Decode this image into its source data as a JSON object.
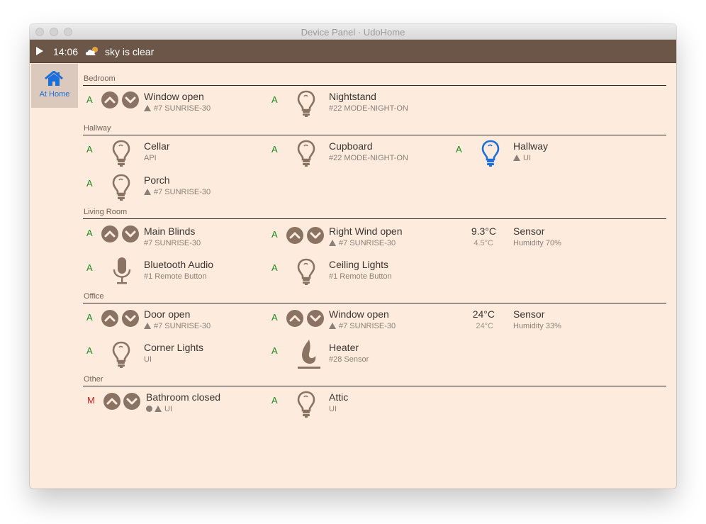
{
  "window": {
    "title": "Device Panel · UdoHome"
  },
  "topbar": {
    "time": "14:06",
    "weather": "sky is clear"
  },
  "sidebar": {
    "home_label": "At Home"
  },
  "colors": {
    "auto": "#1d8a1d",
    "manual": "#d42020",
    "bar": "#6b5648",
    "accent": "#1b6fd9",
    "background": "#fdebde"
  },
  "sections": {
    "bedroom": "Bedroom",
    "hallway": "Hallway",
    "living": "Living Room",
    "office": "Office",
    "other": "Other"
  },
  "devices": {
    "bedroom_window": {
      "mode": "A",
      "name": "Window open",
      "sub": "#7 SUNRISE-30",
      "icon": "up-down-arrows"
    },
    "nightstand": {
      "mode": "A",
      "name": "Nightstand",
      "sub": "#22 MODE-NIGHT-ON",
      "icon": "bulb-icon"
    },
    "cellar": {
      "mode": "A",
      "name": "Cellar",
      "sub": "API",
      "icon": "bulb-icon"
    },
    "cupboard": {
      "mode": "A",
      "name": "Cupboard",
      "sub": "#22 MODE-NIGHT-ON",
      "icon": "bulb-icon"
    },
    "hallway_light": {
      "mode": "A",
      "name": "Hallway",
      "sub": "UI",
      "icon": "bulb-icon-on"
    },
    "porch": {
      "mode": "A",
      "name": "Porch",
      "sub": "#7 SUNRISE-30",
      "icon": "bulb-icon"
    },
    "main_blinds": {
      "mode": "A",
      "name": "Main Blinds",
      "sub": "#7 SUNRISE-30",
      "icon": "up-down-arrows"
    },
    "right_wind": {
      "mode": "A",
      "name": "Right Wind open",
      "sub": "#7 SUNRISE-30",
      "icon": "up-down-arrows"
    },
    "living_sensor": {
      "temp": "9.3°C",
      "temp2": "4.5°C",
      "name": "Sensor",
      "sub": "Humidity 70%"
    },
    "bluetooth": {
      "mode": "A",
      "name": "Bluetooth Audio",
      "sub": "#1 Remote Button",
      "icon": "microphone-icon"
    },
    "ceiling": {
      "mode": "A",
      "name": "Ceiling Lights",
      "sub": "#1 Remote Button",
      "icon": "bulb-icon"
    },
    "door": {
      "mode": "A",
      "name": "Door open",
      "sub": "#7 SUNRISE-30",
      "icon": "up-down-arrows"
    },
    "office_window": {
      "mode": "A",
      "name": "Window open",
      "sub": "#7 SUNRISE-30",
      "icon": "up-down-arrows"
    },
    "office_sensor": {
      "temp": "24°C",
      "temp2": "24°C",
      "name": "Sensor",
      "sub": "Humidity 33%"
    },
    "corner": {
      "mode": "A",
      "name": "Corner Lights",
      "sub": "UI",
      "icon": "bulb-icon"
    },
    "heater": {
      "mode": "A",
      "name": "Heater",
      "sub": "#28 Sensor",
      "icon": "flame-icon"
    },
    "bathroom": {
      "mode": "M",
      "name": "Bathroom closed",
      "sub": "UI",
      "icon": "up-down-arrows"
    },
    "attic": {
      "mode": "A",
      "name": "Attic",
      "sub": "UI",
      "icon": "bulb-icon"
    }
  }
}
